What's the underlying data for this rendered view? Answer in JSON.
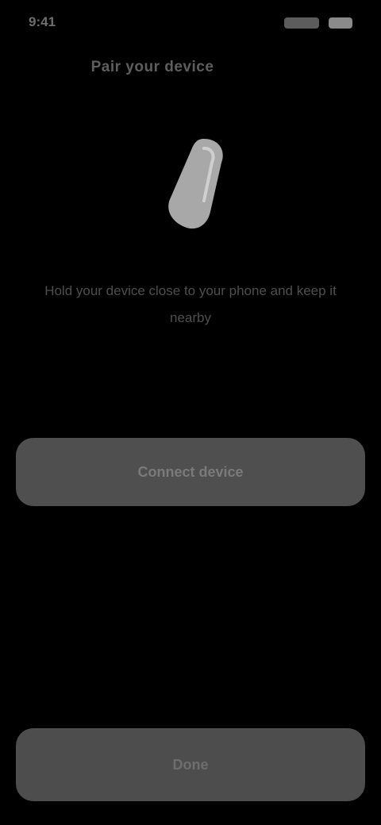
{
  "status_bar": {
    "time": "9:41",
    "icons": [
      "signal-icon",
      "battery-icon"
    ]
  },
  "header": {
    "title": "Pair your device"
  },
  "main": {
    "icon": "device-icon",
    "description": "Hold your device close to your phone and keep it nearby"
  },
  "actions": {
    "primary_label": "Connect device",
    "bottom_label": "Done"
  },
  "colors": {
    "background": "#000000",
    "button": "#4f4f4f",
    "icon": "#a8a8a8"
  }
}
